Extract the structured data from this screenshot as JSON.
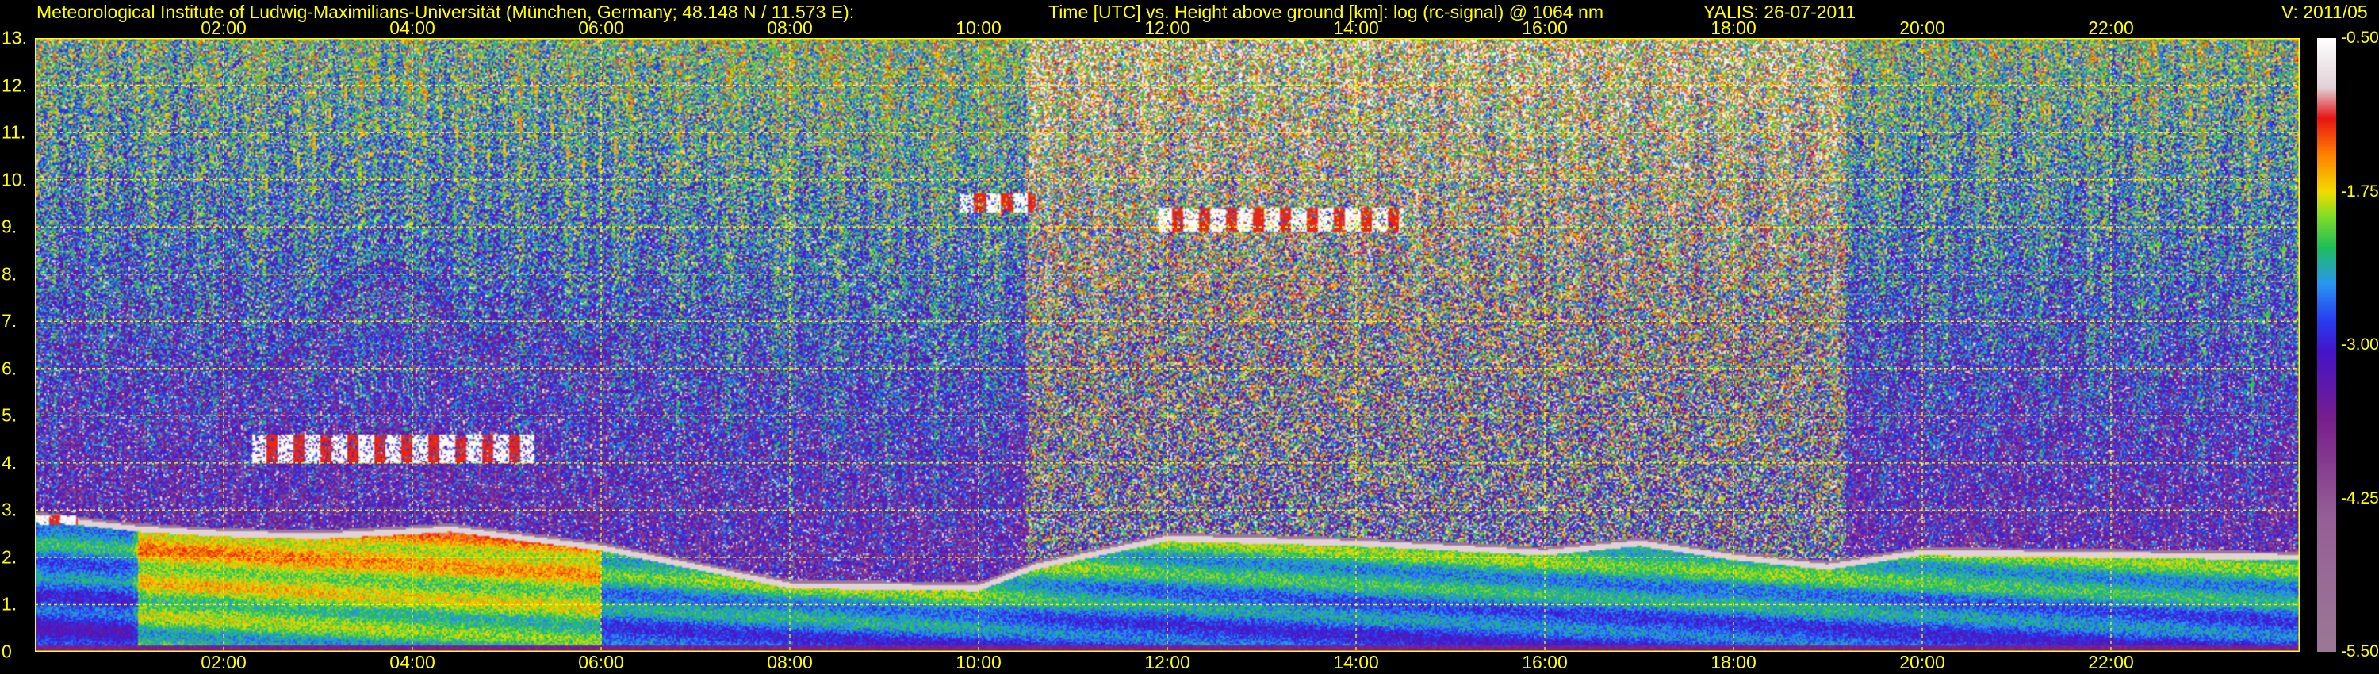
{
  "header": {
    "institute": "Meteorological Institute of Ludwig-Maximilians-Universität (München, Germany; 48.148 N / 11.573 E):",
    "title": "Time [UTC] vs. Height above ground [km]: log (rc-signal) @ 1064 nm",
    "instrument_date": "YALIS: 26-07-2011",
    "version": "V: 2011/05"
  },
  "colors": {
    "text": "#ffff00",
    "grid": "#ffff00",
    "background": "#000000"
  },
  "chart_data": {
    "type": "heatmap",
    "title": "Time [UTC] vs. Height above ground [km]: log (rc-signal) @ 1064 nm",
    "xlabel": "Time [UTC]",
    "ylabel": "Height above ground [km]",
    "xlim": [
      0,
      24
    ],
    "ylim": [
      0,
      13
    ],
    "x_ticks": [
      "02:00",
      "04:00",
      "06:00",
      "08:00",
      "10:00",
      "12:00",
      "14:00",
      "16:00",
      "18:00",
      "20:00",
      "22:00"
    ],
    "y_ticks": [
      "0",
      "1.",
      "2.",
      "3.",
      "4.",
      "5.",
      "6.",
      "7.",
      "8.",
      "9.",
      "10.",
      "11.",
      "12.",
      "13."
    ],
    "grid": true,
    "colorbar": {
      "range": [
        -5.5,
        -0.5
      ],
      "tick_labels": [
        "-0.50",
        "-1.75",
        "-3.00",
        "-4.25",
        "-5.50"
      ],
      "tick_values": [
        -0.5,
        -1.75,
        -3.0,
        -4.25,
        -5.5
      ]
    },
    "features": {
      "boundary_layer_top_km": [
        {
          "t": 0.0,
          "h": 2.85
        },
        {
          "t": 1.1,
          "h": 2.6
        },
        {
          "t": 2.0,
          "h": 2.5
        },
        {
          "t": 3.0,
          "h": 2.45
        },
        {
          "t": 4.0,
          "h": 2.55
        },
        {
          "t": 4.4,
          "h": 2.6
        },
        {
          "t": 6.0,
          "h": 2.2
        },
        {
          "t": 8.0,
          "h": 1.4
        },
        {
          "t": 10.0,
          "h": 1.35
        },
        {
          "t": 10.6,
          "h": 1.8
        },
        {
          "t": 12.0,
          "h": 2.4
        },
        {
          "t": 14.0,
          "h": 2.3
        },
        {
          "t": 16.0,
          "h": 2.1
        },
        {
          "t": 17.0,
          "h": 2.3
        },
        {
          "t": 18.0,
          "h": 2.0
        },
        {
          "t": 19.0,
          "h": 1.8
        },
        {
          "t": 20.0,
          "h": 2.1
        },
        {
          "t": 24.0,
          "h": 2.0
        }
      ],
      "clouds": [
        {
          "t0": 2.3,
          "t1": 5.3,
          "h0": 4.0,
          "h1": 4.6
        },
        {
          "t0": 0.0,
          "t1": 0.45,
          "h0": 2.7,
          "h1": 2.9
        },
        {
          "t0": 9.8,
          "t1": 10.6,
          "h0": 9.3,
          "h1": 9.7
        },
        {
          "t0": 11.9,
          "t1": 14.5,
          "h0": 8.9,
          "h1": 9.4
        }
      ],
      "noisy_daylight_period_h": [
        10.5,
        19.2
      ]
    }
  }
}
